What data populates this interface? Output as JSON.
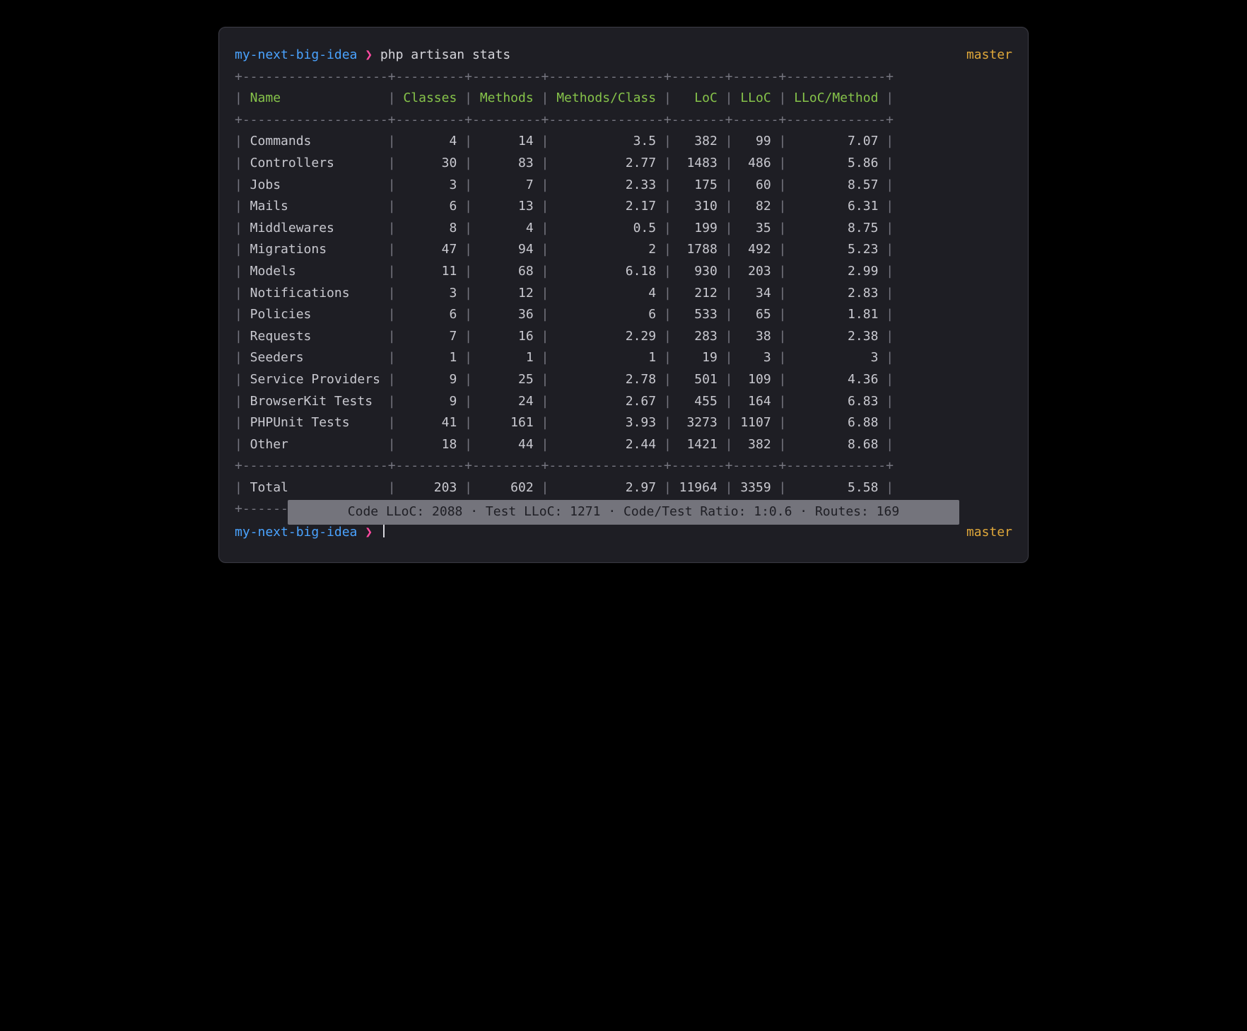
{
  "prompt": {
    "dir": "my-next-big-idea",
    "chevron": "❯",
    "command": "php artisan stats",
    "branch": "master"
  },
  "table": {
    "headers": [
      "Name",
      "Classes",
      "Methods",
      "Methods/Class",
      "LoC",
      "LLoC",
      "LLoC/Method"
    ],
    "rows": [
      {
        "name": "Commands",
        "classes": "4",
        "methods": "14",
        "mpc": "3.5",
        "loc": "382",
        "lloc": "99",
        "llpm": "7.07"
      },
      {
        "name": "Controllers",
        "classes": "30",
        "methods": "83",
        "mpc": "2.77",
        "loc": "1483",
        "lloc": "486",
        "llpm": "5.86"
      },
      {
        "name": "Jobs",
        "classes": "3",
        "methods": "7",
        "mpc": "2.33",
        "loc": "175",
        "lloc": "60",
        "llpm": "8.57"
      },
      {
        "name": "Mails",
        "classes": "6",
        "methods": "13",
        "mpc": "2.17",
        "loc": "310",
        "lloc": "82",
        "llpm": "6.31"
      },
      {
        "name": "Middlewares",
        "classes": "8",
        "methods": "4",
        "mpc": "0.5",
        "loc": "199",
        "lloc": "35",
        "llpm": "8.75"
      },
      {
        "name": "Migrations",
        "classes": "47",
        "methods": "94",
        "mpc": "2",
        "loc": "1788",
        "lloc": "492",
        "llpm": "5.23"
      },
      {
        "name": "Models",
        "classes": "11",
        "methods": "68",
        "mpc": "6.18",
        "loc": "930",
        "lloc": "203",
        "llpm": "2.99"
      },
      {
        "name": "Notifications",
        "classes": "3",
        "methods": "12",
        "mpc": "4",
        "loc": "212",
        "lloc": "34",
        "llpm": "2.83"
      },
      {
        "name": "Policies",
        "classes": "6",
        "methods": "36",
        "mpc": "6",
        "loc": "533",
        "lloc": "65",
        "llpm": "1.81"
      },
      {
        "name": "Requests",
        "classes": "7",
        "methods": "16",
        "mpc": "2.29",
        "loc": "283",
        "lloc": "38",
        "llpm": "2.38"
      },
      {
        "name": "Seeders",
        "classes": "1",
        "methods": "1",
        "mpc": "1",
        "loc": "19",
        "lloc": "3",
        "llpm": "3"
      },
      {
        "name": "Service Providers",
        "classes": "9",
        "methods": "25",
        "mpc": "2.78",
        "loc": "501",
        "lloc": "109",
        "llpm": "4.36"
      },
      {
        "name": "BrowserKit Tests",
        "classes": "9",
        "methods": "24",
        "mpc": "2.67",
        "loc": "455",
        "lloc": "164",
        "llpm": "6.83"
      },
      {
        "name": "PHPUnit Tests",
        "classes": "41",
        "methods": "161",
        "mpc": "3.93",
        "loc": "3273",
        "lloc": "1107",
        "llpm": "6.88"
      },
      {
        "name": "Other",
        "classes": "18",
        "methods": "44",
        "mpc": "2.44",
        "loc": "1421",
        "lloc": "382",
        "llpm": "8.68"
      }
    ],
    "total": {
      "name": "Total",
      "classes": "203",
      "methods": "602",
      "mpc": "2.97",
      "loc": "11964",
      "lloc": "3359",
      "llpm": "5.58"
    }
  },
  "footer": {
    "code_lloc_label": "Code LLoC:",
    "code_lloc": "2088",
    "test_lloc_label": "Test LLoC:",
    "test_lloc": "1271",
    "ratio_label": "Code/Test Ratio:",
    "ratio": "1:0.6",
    "routes_label": "Routes:",
    "routes": "169",
    "sep": "·"
  }
}
